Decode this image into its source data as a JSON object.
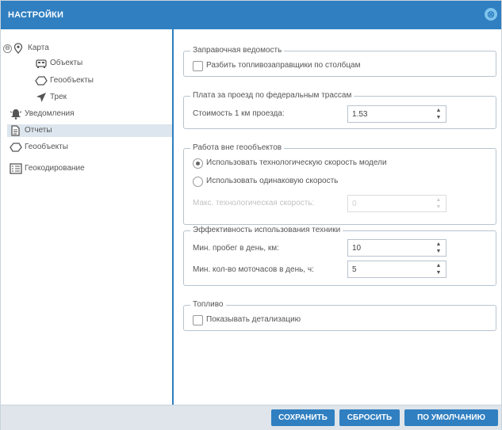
{
  "dialog": {
    "title": "НАСТРОЙКИ",
    "close_glyph": "⊗"
  },
  "sidebar": {
    "items": [
      {
        "label": "Карта",
        "icon": "map-pin-icon",
        "expander": "⊖"
      },
      {
        "label": "Объекты",
        "icon": "car-icon"
      },
      {
        "label": "Геообъекты",
        "icon": "polygon-icon"
      },
      {
        "label": "Трек",
        "icon": "arrow-icon"
      },
      {
        "label": "Уведомления",
        "icon": "bell-icon"
      },
      {
        "label": "Отчеты",
        "icon": "document-icon"
      },
      {
        "label": "Геообъекты",
        "icon": "polygon-icon"
      },
      {
        "label": "Геокодирование",
        "icon": "list-icon"
      }
    ]
  },
  "sections": {
    "fuel_sheet": {
      "legend": "Заправочная ведомость",
      "checkbox_label": "Разбить топливозаправщики по столбцам"
    },
    "toll": {
      "legend": "Плата за проезд по федеральным трассам",
      "cost_label": "Стоимость 1 км проезда:",
      "cost_value": "1.53"
    },
    "outside_geo": {
      "legend": "Работа вне геообъектов",
      "radio1_label": "Использовать технологическую скорость модели",
      "radio2_label": "Использовать одинаковую скорость",
      "max_speed_label": "Макс. технологическая скорость:",
      "max_speed_value": "0"
    },
    "efficiency": {
      "legend": "Эффективность использования техники",
      "mileage_label": "Мин. пробег в день, км:",
      "mileage_value": "10",
      "motohours_label": "Мин. кол-во моточасов в день, ч:",
      "motohours_value": "5"
    },
    "fuel": {
      "legend": "Топливо",
      "checkbox_label": "Показывать детализацию"
    }
  },
  "footer": {
    "save": "СОХРАНИТЬ",
    "reset": "СБРОСИТЬ",
    "defaults": "ПО УМОЛЧАНИЮ"
  },
  "colors": {
    "accent": "#2f7fc1",
    "selected_row": "#dde6ee",
    "footer_bg": "#dfe5ea"
  }
}
